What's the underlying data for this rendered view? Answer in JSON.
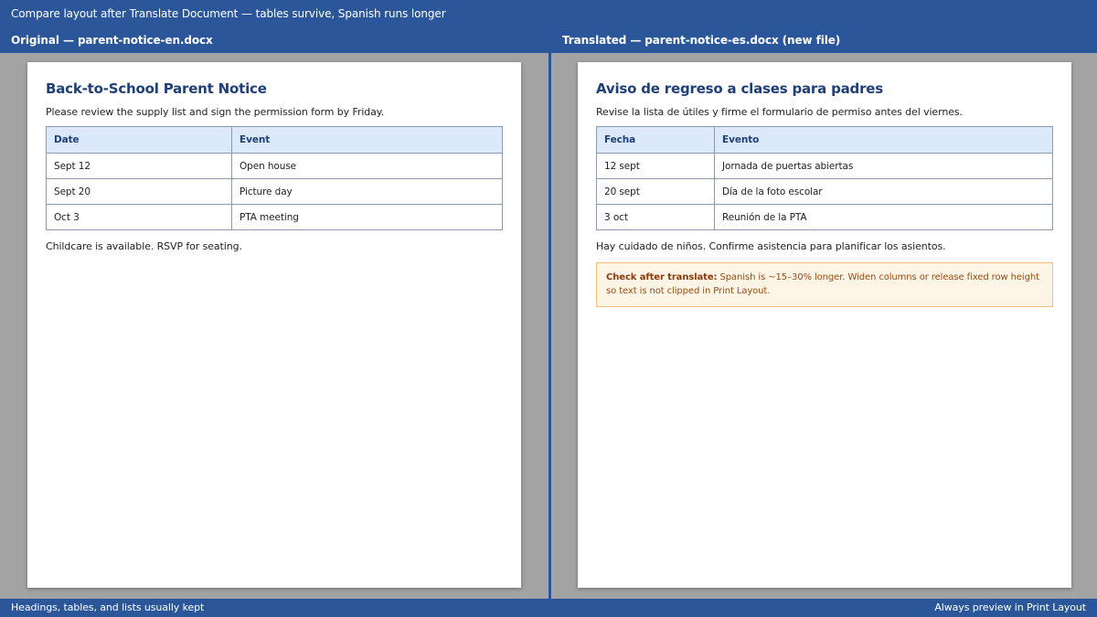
{
  "header": {
    "title": "Compare layout after Translate Document — tables survive, Spanish runs longer",
    "left_label": "Original — parent-notice-en.docx",
    "right_label": "Translated — parent-notice-es.docx (new file)"
  },
  "original": {
    "title": "Back-to-School Parent Notice",
    "intro": "Please review the supply list and sign the permission form by Friday.",
    "table": {
      "headers": [
        "Date",
        "Event"
      ],
      "rows": [
        [
          "Sept 12",
          "Open house"
        ],
        [
          "Sept 20",
          "Picture day"
        ],
        [
          "Oct 3",
          "PTA meeting"
        ]
      ]
    },
    "footer": "Childcare is available. RSVP for seating."
  },
  "translated": {
    "title": "Aviso de regreso a clases para padres",
    "intro": "Revise la lista de útiles y firme el formulario de permiso antes del viernes.",
    "table": {
      "headers": [
        "Fecha",
        "Evento"
      ],
      "rows": [
        [
          "12 sept",
          "Jornada de puertas abiertas"
        ],
        [
          "20 sept",
          "Día de la foto escolar"
        ],
        [
          "3 oct",
          "Reunión de la PTA"
        ]
      ]
    },
    "footer": "Hay cuidado de niños. Confirme asistencia para planificar los asientos.",
    "callout": {
      "lead": "Check after translate:",
      "text": " Spanish is ~15–30% longer. Widen columns or release fixed row height so text is not clipped in Print Layout."
    }
  },
  "status": {
    "left": "Headings, tables, and lists usually kept",
    "right": "Always preview in Print Layout"
  },
  "colors": {
    "chrome": "#2b579a",
    "heading": "#1f3f77",
    "table_header_bg": "#dce9fb",
    "callout_bg": "#fff5e6",
    "callout_border": "#f0c07a"
  }
}
